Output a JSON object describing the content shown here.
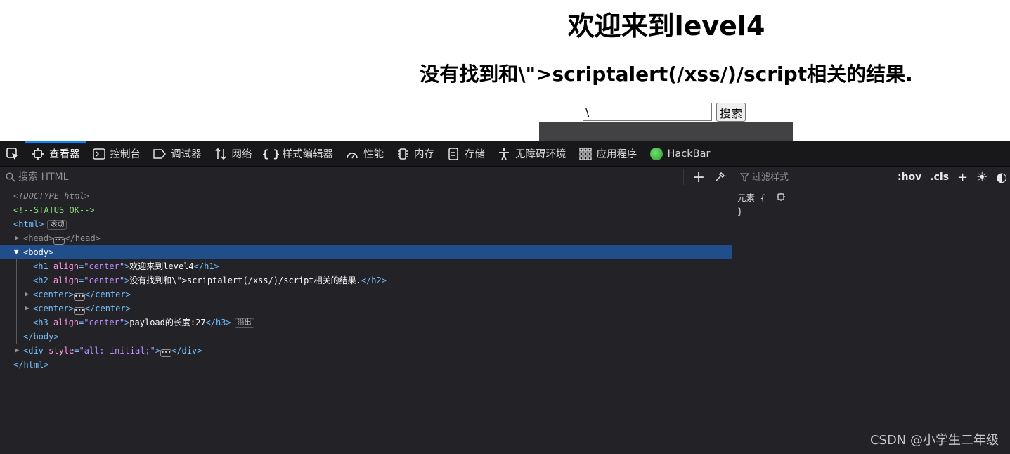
{
  "page": {
    "h1": "欢迎来到level4",
    "h2": "没有找到和\\\">scriptalert(/xss/)/script相关的结果.",
    "search_value": "\\",
    "search_button": "搜索"
  },
  "devtools": {
    "tabs": [
      {
        "label": "查看器",
        "icon": "inspector-icon",
        "active": true
      },
      {
        "label": "控制台",
        "icon": "console-icon"
      },
      {
        "label": "调试器",
        "icon": "debugger-icon"
      },
      {
        "label": "网络",
        "icon": "network-icon"
      },
      {
        "label": "样式编辑器",
        "icon": "braces-icon"
      },
      {
        "label": "性能",
        "icon": "performance-icon"
      },
      {
        "label": "内存",
        "icon": "memory-icon"
      },
      {
        "label": "存储",
        "icon": "storage-icon"
      },
      {
        "label": "无障碍环境",
        "icon": "accessibility-icon"
      },
      {
        "label": "应用程序",
        "icon": "application-icon"
      },
      {
        "label": "HackBar",
        "icon": "hackbar-icon"
      }
    ],
    "markup_search_placeholder": "搜索 HTML",
    "tree": {
      "doctype": "<!DOCTYPE html>",
      "comment": "<!--STATUS OK-->",
      "html_open": "<html>",
      "scroll_badge": "滚动",
      "head_open": "<head>",
      "head_close": "</head>",
      "body_open": "<body>",
      "h1_tag_open": "<h1 ",
      "h1_attr": "align",
      "h1_val": "\"center\"",
      "h1_text": "欢迎来到level4",
      "h1_close": "</h1>",
      "h2_tag_open": "<h2 ",
      "h2_attr": "align",
      "h2_val": "\"center\"",
      "h2_text": "没有找到和\\\">scriptalert(/xss/)/script相关的结果.",
      "h2_close": "</h2>",
      "center_open": "<center>",
      "center_close": "</center>",
      "h3_tag_open": "<h3 ",
      "h3_attr": "align",
      "h3_val": "\"center\"",
      "h3_text": "payload的长度:27",
      "h3_close": "</h3>",
      "overflow_badge": "溢出",
      "body_close": "</body>",
      "div_tag_open": "<div ",
      "div_attr": "style",
      "div_val": "\"all: initial;\"",
      "div_close": "</div>",
      "html_close": "</html>"
    },
    "rules": {
      "filter_placeholder": "过滤样式",
      "hov": ":hov",
      "cls": ".cls",
      "element_label": "元素 {",
      "close_brace": "}"
    }
  },
  "watermark": "CSDN @小学生二年级",
  "colors": {
    "selection": "#204e8a",
    "tag": "#75bfff",
    "attr_name": "#ff97e6",
    "attr_value": "#b98eff",
    "comment": "#86de74",
    "active_tab": "#0a84ff"
  }
}
